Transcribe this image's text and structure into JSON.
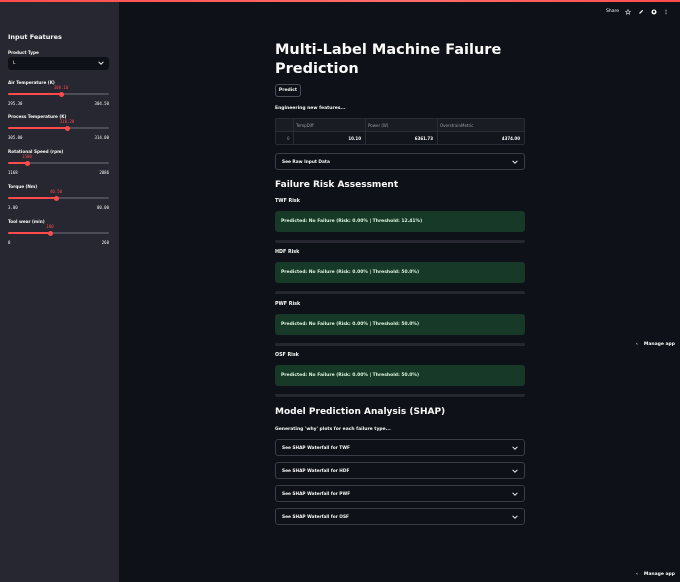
{
  "header": {
    "share_label": "Share",
    "icons": [
      "star-icon",
      "edit-icon",
      "github-icon",
      "more-vertical-icon"
    ]
  },
  "sidebar": {
    "title": "Input Features",
    "product_type": {
      "label": "Product Type",
      "value": "L"
    },
    "sliders": [
      {
        "label": "Air Temperature (K)",
        "value": "300.10",
        "min": "295.30",
        "max": "304.50",
        "fraction": 0.52
      },
      {
        "label": "Process Temperature (K)",
        "value": "310.20",
        "min": "305.00",
        "max": "314.00",
        "fraction": 0.58
      },
      {
        "label": "Rotational Speed (rpm)",
        "value": "1500",
        "min": "1168",
        "max": "2886",
        "fraction": 0.19
      },
      {
        "label": "Torque (Nm)",
        "value": "40.50",
        "min": "3.80",
        "max": "80.00",
        "fraction": 0.48
      },
      {
        "label": "Tool wear (min)",
        "value": "100",
        "min": "0",
        "max": "260",
        "fraction": 0.42
      }
    ]
  },
  "main": {
    "title": "Multi-Label Machine Failure Prediction",
    "predict_label": "Predict",
    "engineering_text": "Engineering new features...",
    "table": {
      "columns": [
        "",
        "TempDiff",
        "Power (W)",
        "OverstrainMetric"
      ],
      "rows": [
        [
          "0",
          "10.10",
          "6361.73",
          "4374.00"
        ]
      ]
    },
    "raw_input_expander": "See Raw Input Data",
    "risk_heading": "Failure Risk Assessment",
    "risks": [
      {
        "label": "TWF Risk",
        "message": "Predicted: No Failure (Risk: 0.00% | Threshold: 12.41%)"
      },
      {
        "label": "HDF Risk",
        "message": "Predicted: No Failure (Risk: 0.00% | Threshold: 50.0%)"
      },
      {
        "label": "PWF Risk",
        "message": "Predicted: No Failure (Risk: 0.00% | Threshold: 50.0%)"
      },
      {
        "label": "OSF Risk",
        "message": "Predicted: No Failure (Risk: 0.00% | Threshold: 50.0%)"
      }
    ],
    "shap_heading": "Model Prediction Analysis (SHAP)",
    "shap_text": "Generating 'why' plots for each failure type...",
    "shap_expanders": [
      "See SHAP Waterfall for TWF",
      "See SHAP Waterfall for HDF",
      "See SHAP Waterfall for PWF",
      "See SHAP Waterfall for OSF"
    ]
  },
  "manage_app_label": "Manage app",
  "colors": {
    "accent": "#ff4b4b",
    "success_bg": "#173928",
    "sidebar_bg": "#262730",
    "app_bg": "#0e1117"
  }
}
